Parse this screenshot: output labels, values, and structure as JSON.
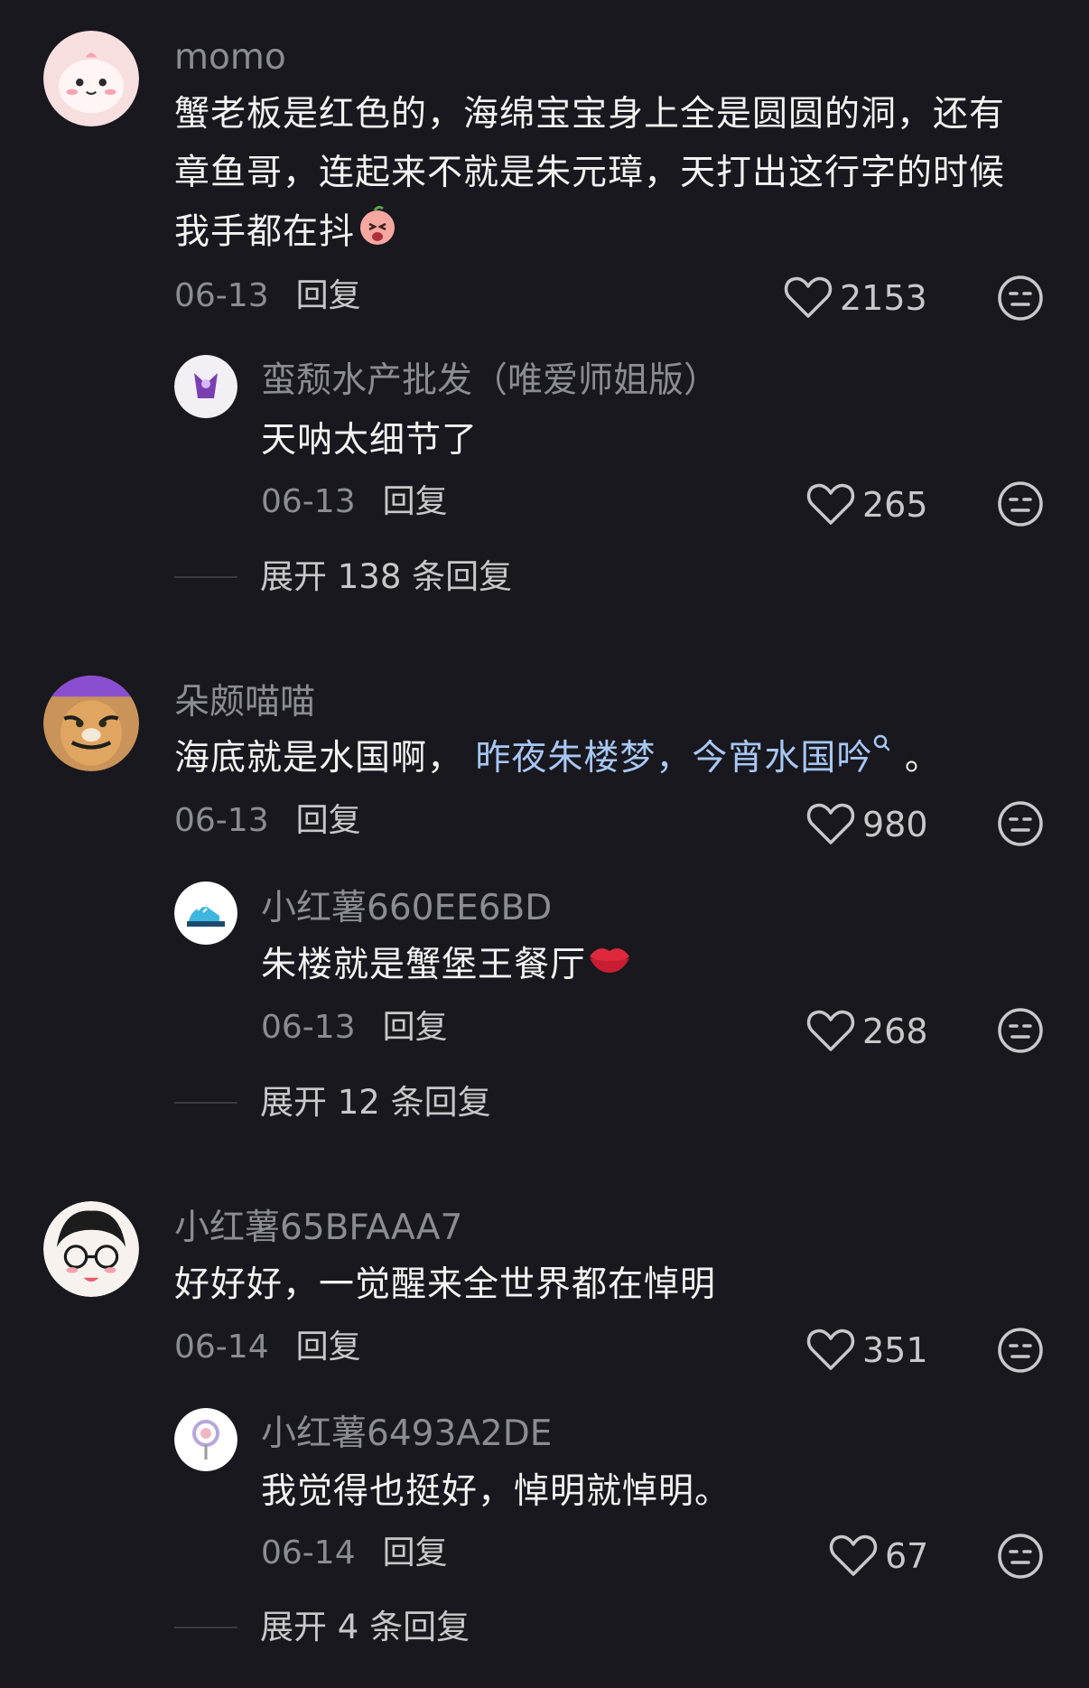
{
  "threads": [
    {
      "user": "momo",
      "text_lines": [
        "蟹老板是红色的，海绵宝宝身上全是圆圆的洞，还有",
        "章鱼哥，连起来不就是朱元璋，天打出这行字的时候",
        "我手都在抖"
      ],
      "emoji": "peach-face-emoji",
      "date": "06-13",
      "reply_label": "回复",
      "likes": "2153",
      "reply": {
        "user": "蛮颓水产批发（唯爱师姐版）",
        "text": "天呐太细节了",
        "date": "06-13",
        "reply_label": "回复",
        "likes": "265"
      },
      "expand": "展开 138 条回复"
    },
    {
      "user": "朵颇喵喵",
      "text_prefix": "海底就是水国啊，",
      "text_link": "昨夜朱楼梦，今宵水国吟",
      "text_suffix": "。",
      "date": "06-13",
      "reply_label": "回复",
      "likes": "980",
      "reply": {
        "user": "小红薯660EE6BD",
        "text": "朱楼就是蟹堡王餐厅",
        "date": "06-13",
        "reply_label": "回复",
        "likes": "268"
      },
      "expand": "展开 12 条回复"
    },
    {
      "user": "小红薯65BFAAA7",
      "text": "好好好，一觉醒来全世界都在悼明",
      "date": "06-14",
      "reply_label": "回复",
      "likes": "351",
      "reply": {
        "user": "小红薯6493A2DE",
        "text": "我觉得也挺好，悼明就悼明。",
        "date": "06-14",
        "reply_label": "回复",
        "likes": "67"
      },
      "expand": "展开 4 条回复"
    }
  ],
  "colors": {
    "background": "#18181e",
    "username": "#8c8c93",
    "body": "#f3f3f3",
    "link": "#a8c7f5"
  }
}
